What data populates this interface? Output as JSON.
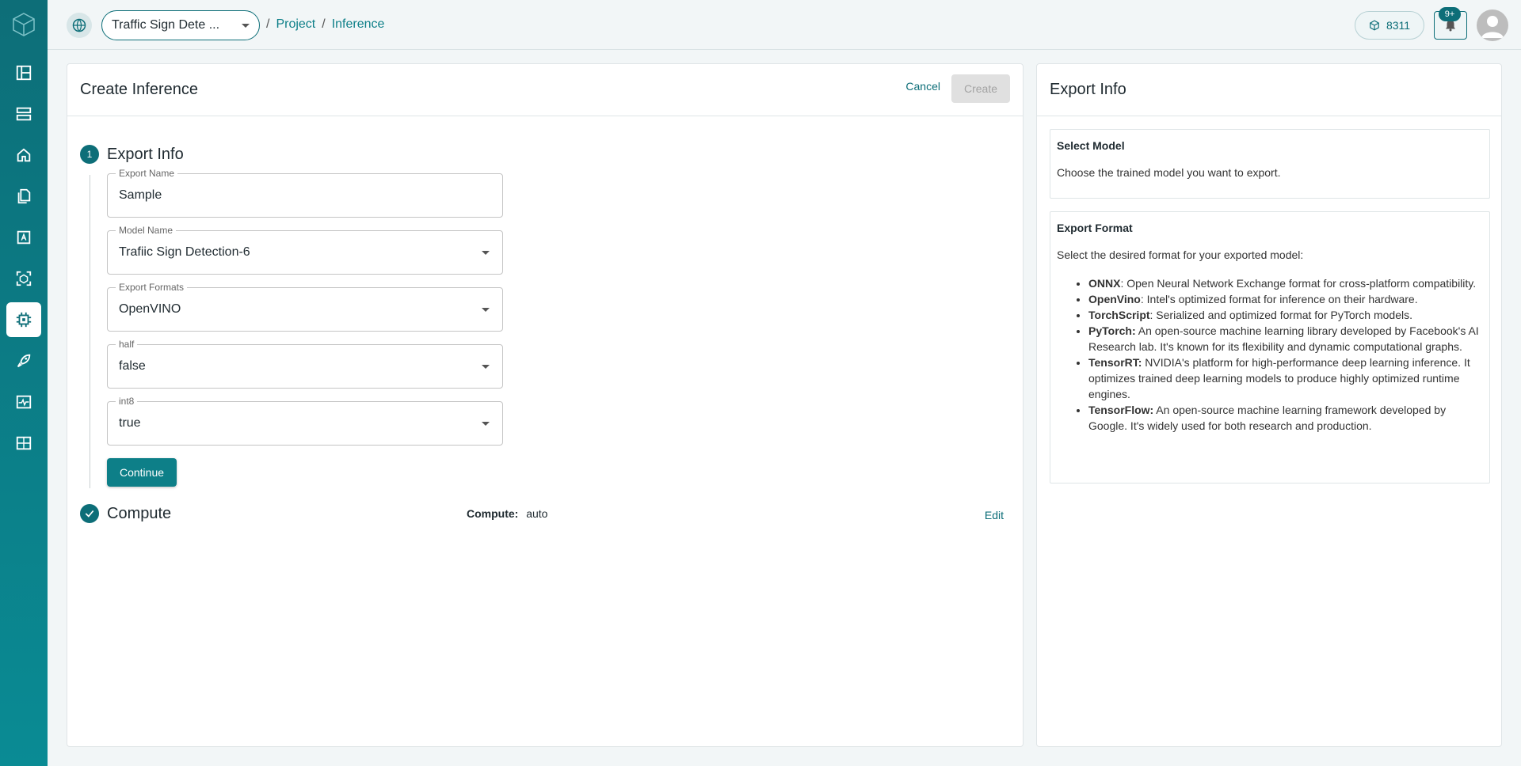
{
  "header": {
    "project_name": "Traffic Sign Dete ...",
    "breadcrumb": [
      "Project",
      "Inference"
    ],
    "credits": "8311",
    "notifications_badge": "9+"
  },
  "main": {
    "title": "Create Inference",
    "cancel_label": "Cancel",
    "create_label": "Create",
    "step1": {
      "number": "1",
      "title": "Export Info",
      "fields": [
        {
          "label": "Export Name",
          "value": "Sample"
        },
        {
          "label": "Model Name",
          "value": "Trafiic Sign Detection-6"
        },
        {
          "label": "Export Formats",
          "value": "OpenVINO"
        },
        {
          "label": "half",
          "value": "false"
        },
        {
          "label": "int8",
          "value": "true"
        }
      ],
      "continue_label": "Continue"
    },
    "step2": {
      "title": "Compute",
      "compute_label": "Compute:",
      "compute_value": "auto",
      "edit_label": "Edit"
    }
  },
  "side": {
    "title": "Export Info",
    "select_model": {
      "heading": "Select Model",
      "text": "Choose the trained model you want to export."
    },
    "export_format": {
      "heading": "Export Format",
      "text": "Select the desired format for your exported model:",
      "items": [
        {
          "name": "ONNX",
          "desc": ": Open Neural Network Exchange format for cross-platform compatibility."
        },
        {
          "name": "OpenVino",
          "desc": ": Intel's optimized format for inference on their hardware."
        },
        {
          "name": "TorchScript",
          "desc": ": Serialized and optimized format for PyTorch models."
        },
        {
          "name": "PyTorch:",
          "desc": " An open-source machine learning library developed by Facebook's AI Research lab. It's known for its flexibility and dynamic computational graphs."
        },
        {
          "name": "TensorRT:",
          "desc": " NVIDIA's platform for high-performance deep learning inference. It optimizes trained deep learning models to produce highly optimized runtime engines."
        },
        {
          "name": "TensorFlow:",
          "desc": " An open-source machine learning framework developed by Google. It's widely used for both research and production."
        }
      ]
    }
  },
  "icons": {
    "logo": "cube-logo-icon",
    "nav": [
      "dashboard-icon",
      "datasets-icon",
      "home-icon",
      "files-icon",
      "annotate-icon",
      "models-icon",
      "inference-icon",
      "deploy-icon",
      "monitor-icon",
      "analytics-icon"
    ]
  },
  "colors": {
    "accent": "#0d6e78",
    "sidebar_top": "#0d6e78",
    "sidebar_bottom": "#0a8b94"
  }
}
